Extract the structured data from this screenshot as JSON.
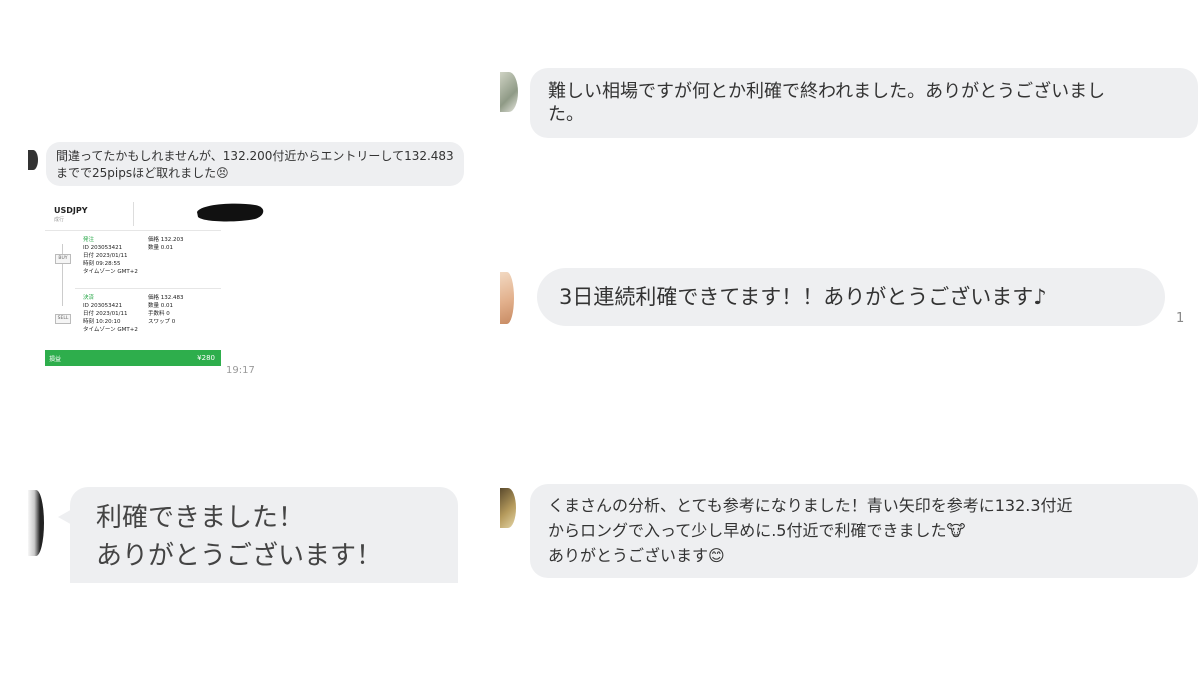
{
  "chat1": {
    "message": "間違ってたかもしれませんが、132.200付近からエントリーして132.483までで25pipsほど取れました😣",
    "time": "19:17",
    "trade_card": {
      "symbol": "USDJPY",
      "symbol_sub": "成行",
      "open": {
        "label": "発注",
        "id": "ID 203053421",
        "date": "日付 2023/01/11",
        "time": "時刻 09:28:55",
        "timezone": "タイムゾーン GMT+2",
        "price": "価格 132.203",
        "qty": "数量 0.01",
        "side": "BUY"
      },
      "close": {
        "label": "決済",
        "id": "ID 203053421",
        "date": "日付 2023/01/11",
        "time": "時刻 10:20:10",
        "timezone": "タイムゾーン GMT+2",
        "price": "価格 132.483",
        "qty": "数量 0.01",
        "fee": "手数料 0",
        "swap": "スワップ 0",
        "side": "SELL"
      },
      "result_label": "損益",
      "result_value": "¥280",
      "bar_color": "#2eae4c"
    }
  },
  "chat2": {
    "line1": "難しい相場ですが何とか利確で終われました。ありがとうございまし",
    "line2": "た。"
  },
  "chat3": {
    "message": "3日連続利確できてます！！ありがとうございます♪",
    "read_count": "1"
  },
  "chat4": {
    "line1": "利確できました！",
    "line2": "ありがとうございます！"
  },
  "chat5": {
    "line1": "くまさんの分析、とても参考になりました！青い矢印を参考に132.3付近",
    "line2": "からロングで入って少し早めに.5付近で利確できました🐮",
    "line3": "ありがとうございます😊"
  },
  "colors": {
    "bubble": "#eeeff1",
    "accent_green": "#2eae4c",
    "text": "#2b2b2b"
  }
}
